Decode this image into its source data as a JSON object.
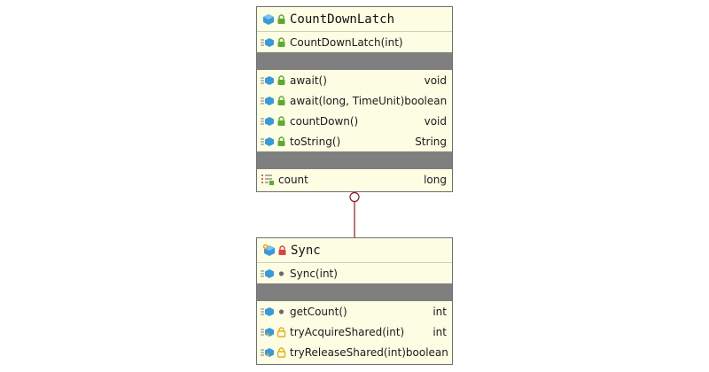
{
  "classes": {
    "countdownlatch": {
      "name": "CountDownLatch",
      "constructors": [
        {
          "name": "CountDownLatch(int)",
          "type": ""
        }
      ],
      "methods": [
        {
          "name": "await()",
          "type": "void"
        },
        {
          "name": "await(long, TimeUnit)",
          "type": "boolean"
        },
        {
          "name": "countDown()",
          "type": "void"
        },
        {
          "name": "toString()",
          "type": "String"
        }
      ],
      "fields": [
        {
          "name": "count",
          "type": "long"
        }
      ]
    },
    "sync": {
      "name": "Sync",
      "constructors": [
        {
          "name": "Sync(int)",
          "type": ""
        }
      ],
      "methods": [
        {
          "name": "getCount()",
          "type": "int"
        },
        {
          "name": "tryAcquireShared(int)",
          "type": "int"
        },
        {
          "name": "tryReleaseShared(int)",
          "type": "boolean"
        }
      ]
    }
  },
  "colors": {
    "box_bg": "#fdfde4",
    "separator": "#7f7f7f",
    "connector": "#8b1a1a",
    "public_lock": "#5fa832",
    "private_lock": "#d64545",
    "protected_lock": "#e0b020",
    "class_icon": "#3a9ad9"
  }
}
